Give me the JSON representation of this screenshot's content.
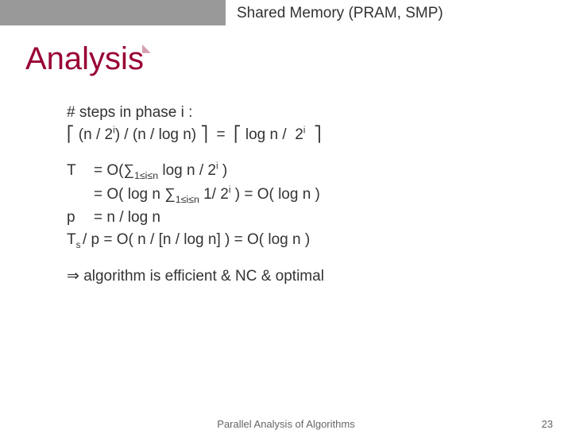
{
  "header": {
    "label": "Shared Memory (PRAM, SMP)"
  },
  "title": "Analysis",
  "body": {
    "phase_line": "# steps in phase i :",
    "phase_eq": "⎡ (n / 2ⁱ) / (n / log n) ⎤ = ⎡ log n /  2ⁱ ⎤",
    "T_label": "T",
    "T_eq1_pre": "= O(∑",
    "T_eq1_sub": "1≤i≤n",
    "T_eq1_post": " log n / 2ⁱ )",
    "T_eq2_pre": "= O( log n ∑",
    "T_eq2_sub": "1≤i≤n",
    "T_eq2_post": " 1/ 2ⁱ ) = O( log n )",
    "p_label": "p",
    "p_eq": "= n / log n",
    "Ts_label_T": "T",
    "Ts_label_s": "s",
    "Ts_eq": " / p = O( n / [n / log n] ) = O( log n )",
    "conclusion": "algorithm is efficient & NC & optimal"
  },
  "footer": {
    "center": "Parallel Analysis of Algorithms",
    "page": "23"
  }
}
